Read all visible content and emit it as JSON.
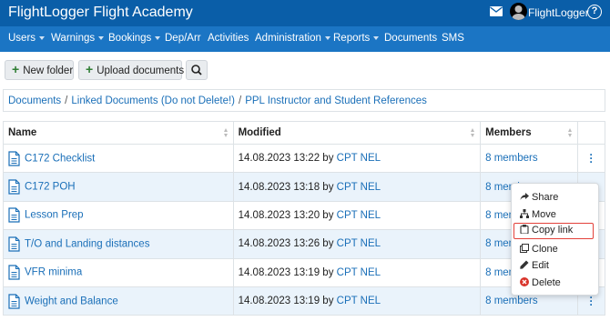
{
  "header": {
    "brand": "FlightLogger Flight Academy",
    "username": "FlightLogger",
    "help": "?"
  },
  "nav": [
    {
      "label": "Users",
      "dropdown": true
    },
    {
      "label": "Warnings",
      "dropdown": true
    },
    {
      "label": "Bookings",
      "dropdown": true
    },
    {
      "label": "Dep/Arr",
      "dropdown": false
    },
    {
      "label": "Activities",
      "dropdown": false
    },
    {
      "label": "Administration",
      "dropdown": true
    },
    {
      "label": "Reports",
      "dropdown": true
    },
    {
      "label": "Documents",
      "dropdown": false
    },
    {
      "label": "SMS",
      "dropdown": false
    }
  ],
  "toolbar": {
    "new_folder": "New folder",
    "upload_documents": "Upload documents"
  },
  "breadcrumb": [
    "Documents",
    "Linked Documents (Do not Delete!)",
    "PPL Instructor and Student References"
  ],
  "table": {
    "headers": [
      "Name",
      "Modified",
      "Members"
    ],
    "rows": [
      {
        "name": "C172 Checklist",
        "modified": "14.08.2023 13:22",
        "by": "by",
        "user": "CPT NEL",
        "members": "8 members"
      },
      {
        "name": "C172 POH",
        "modified": "14.08.2023 13:18",
        "by": "by",
        "user": "CPT NEL",
        "members": "8 members"
      },
      {
        "name": "Lesson Prep",
        "modified": "14.08.2023 13:20",
        "by": "by",
        "user": "CPT NEL",
        "members": "8 members"
      },
      {
        "name": "T/O and Landing distances",
        "modified": "14.08.2023 13:26",
        "by": "by",
        "user": "CPT NEL",
        "members": "8 members"
      },
      {
        "name": "VFR minima",
        "modified": "14.08.2023 13:19",
        "by": "by",
        "user": "CPT NEL",
        "members": "8 members"
      },
      {
        "name": "Weight and Balance",
        "modified": "14.08.2023 13:19",
        "by": "by",
        "user": "CPT NEL",
        "members": "8 members"
      }
    ]
  },
  "menu": {
    "items": [
      {
        "label": "Share",
        "icon": "share-icon"
      },
      {
        "label": "Move",
        "icon": "sitemap-icon"
      },
      {
        "label": "Copy link",
        "icon": "clipboard-icon",
        "highlighted": true
      },
      {
        "label": "Clone",
        "icon": "clone-icon"
      },
      {
        "label": "Edit",
        "icon": "pencil-icon"
      },
      {
        "label": "Delete",
        "icon": "delete-icon"
      }
    ]
  },
  "colors": {
    "header_dark": "#0a5ea8",
    "nav_blue": "#1b75c4",
    "link": "#1a6fb8",
    "row_alt": "#eaf3fb",
    "highlight_border": "#e3413a",
    "delete_red": "#d9342b",
    "plus_green": "#2e7d32"
  }
}
